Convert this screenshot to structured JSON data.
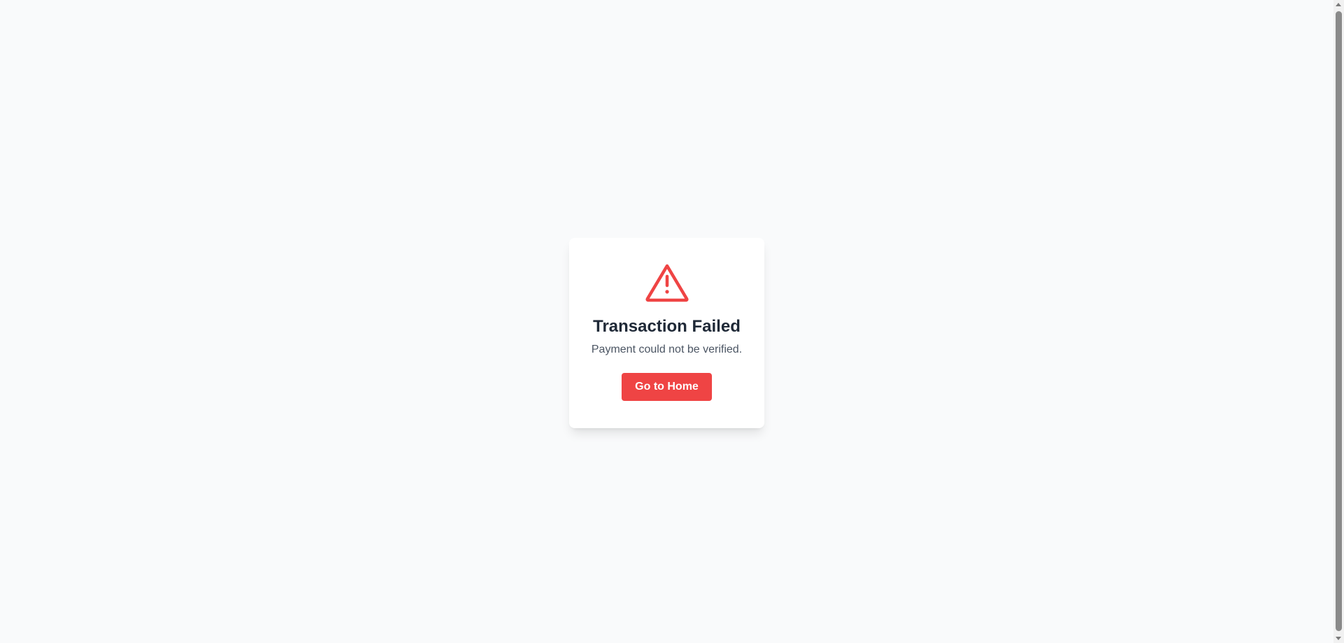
{
  "card": {
    "icon": "warning-triangle-icon",
    "title": "Transaction Failed",
    "message": "Payment could not be verified.",
    "button_label": "Go to Home"
  },
  "colors": {
    "page_background": "#f9fafb",
    "card_background": "#ffffff",
    "accent_red": "#ef4444",
    "title_text": "#1f2937",
    "message_text": "#4b5563"
  }
}
